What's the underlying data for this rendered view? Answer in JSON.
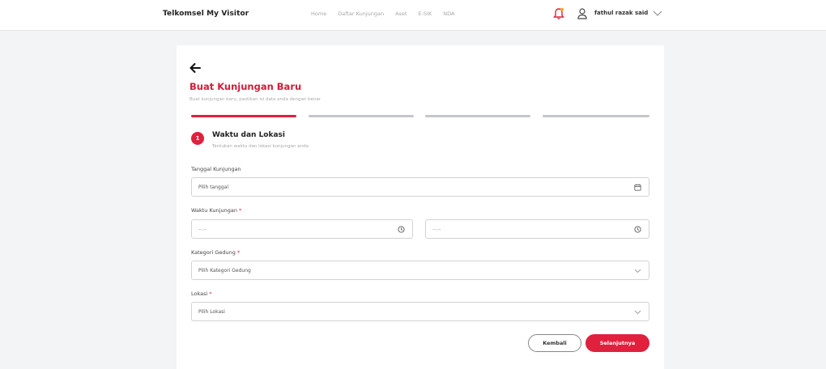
{
  "app": {
    "brand": "Telkomsel My Visitor"
  },
  "nav": {
    "items": [
      {
        "label": "Home"
      },
      {
        "label": "Daftar Kunjungan"
      },
      {
        "label": "Aset"
      },
      {
        "label": "E-SIK"
      },
      {
        "label": "NDA"
      }
    ]
  },
  "user": {
    "name": "fathul razak said"
  },
  "icons": {
    "back": "arrow-left-icon",
    "notification": "bell-icon",
    "user": "user-icon",
    "calendar": "calendar-icon",
    "clock": "clock-icon",
    "chevron": "chevron-down-icon"
  },
  "colors": {
    "accent": "#e0203d",
    "title": "#d41b3a",
    "inactive_step": "#c4c6cc"
  },
  "page": {
    "title": "Buat Kunjungan Baru",
    "subtitle": "Buat kunjungan baru, pastikan isi data anda dengan benar"
  },
  "stepper": {
    "current": 1,
    "total": 4
  },
  "step": {
    "number": "1",
    "title": "Waktu dan Lokasi",
    "description": "Tentukan waktu dan lokasi kunjungan anda"
  },
  "form": {
    "tanggal": {
      "label": "Tanggal Kunjungan",
      "placeholder": "Pilih tanggal"
    },
    "waktu": {
      "label": "Waktu Kunjungan",
      "required": "*",
      "start_value": "--.--",
      "end_value": "--.--"
    },
    "kategori": {
      "label": "Kategori Gedung",
      "required": "*",
      "placeholder": "Pilih Kategori Gedung"
    },
    "lokasi": {
      "label": "Lokasi",
      "required": "*",
      "placeholder": "Pilih Lokasi"
    }
  },
  "actions": {
    "back_label": "Kembali",
    "next_label": "Selanjutnya"
  }
}
